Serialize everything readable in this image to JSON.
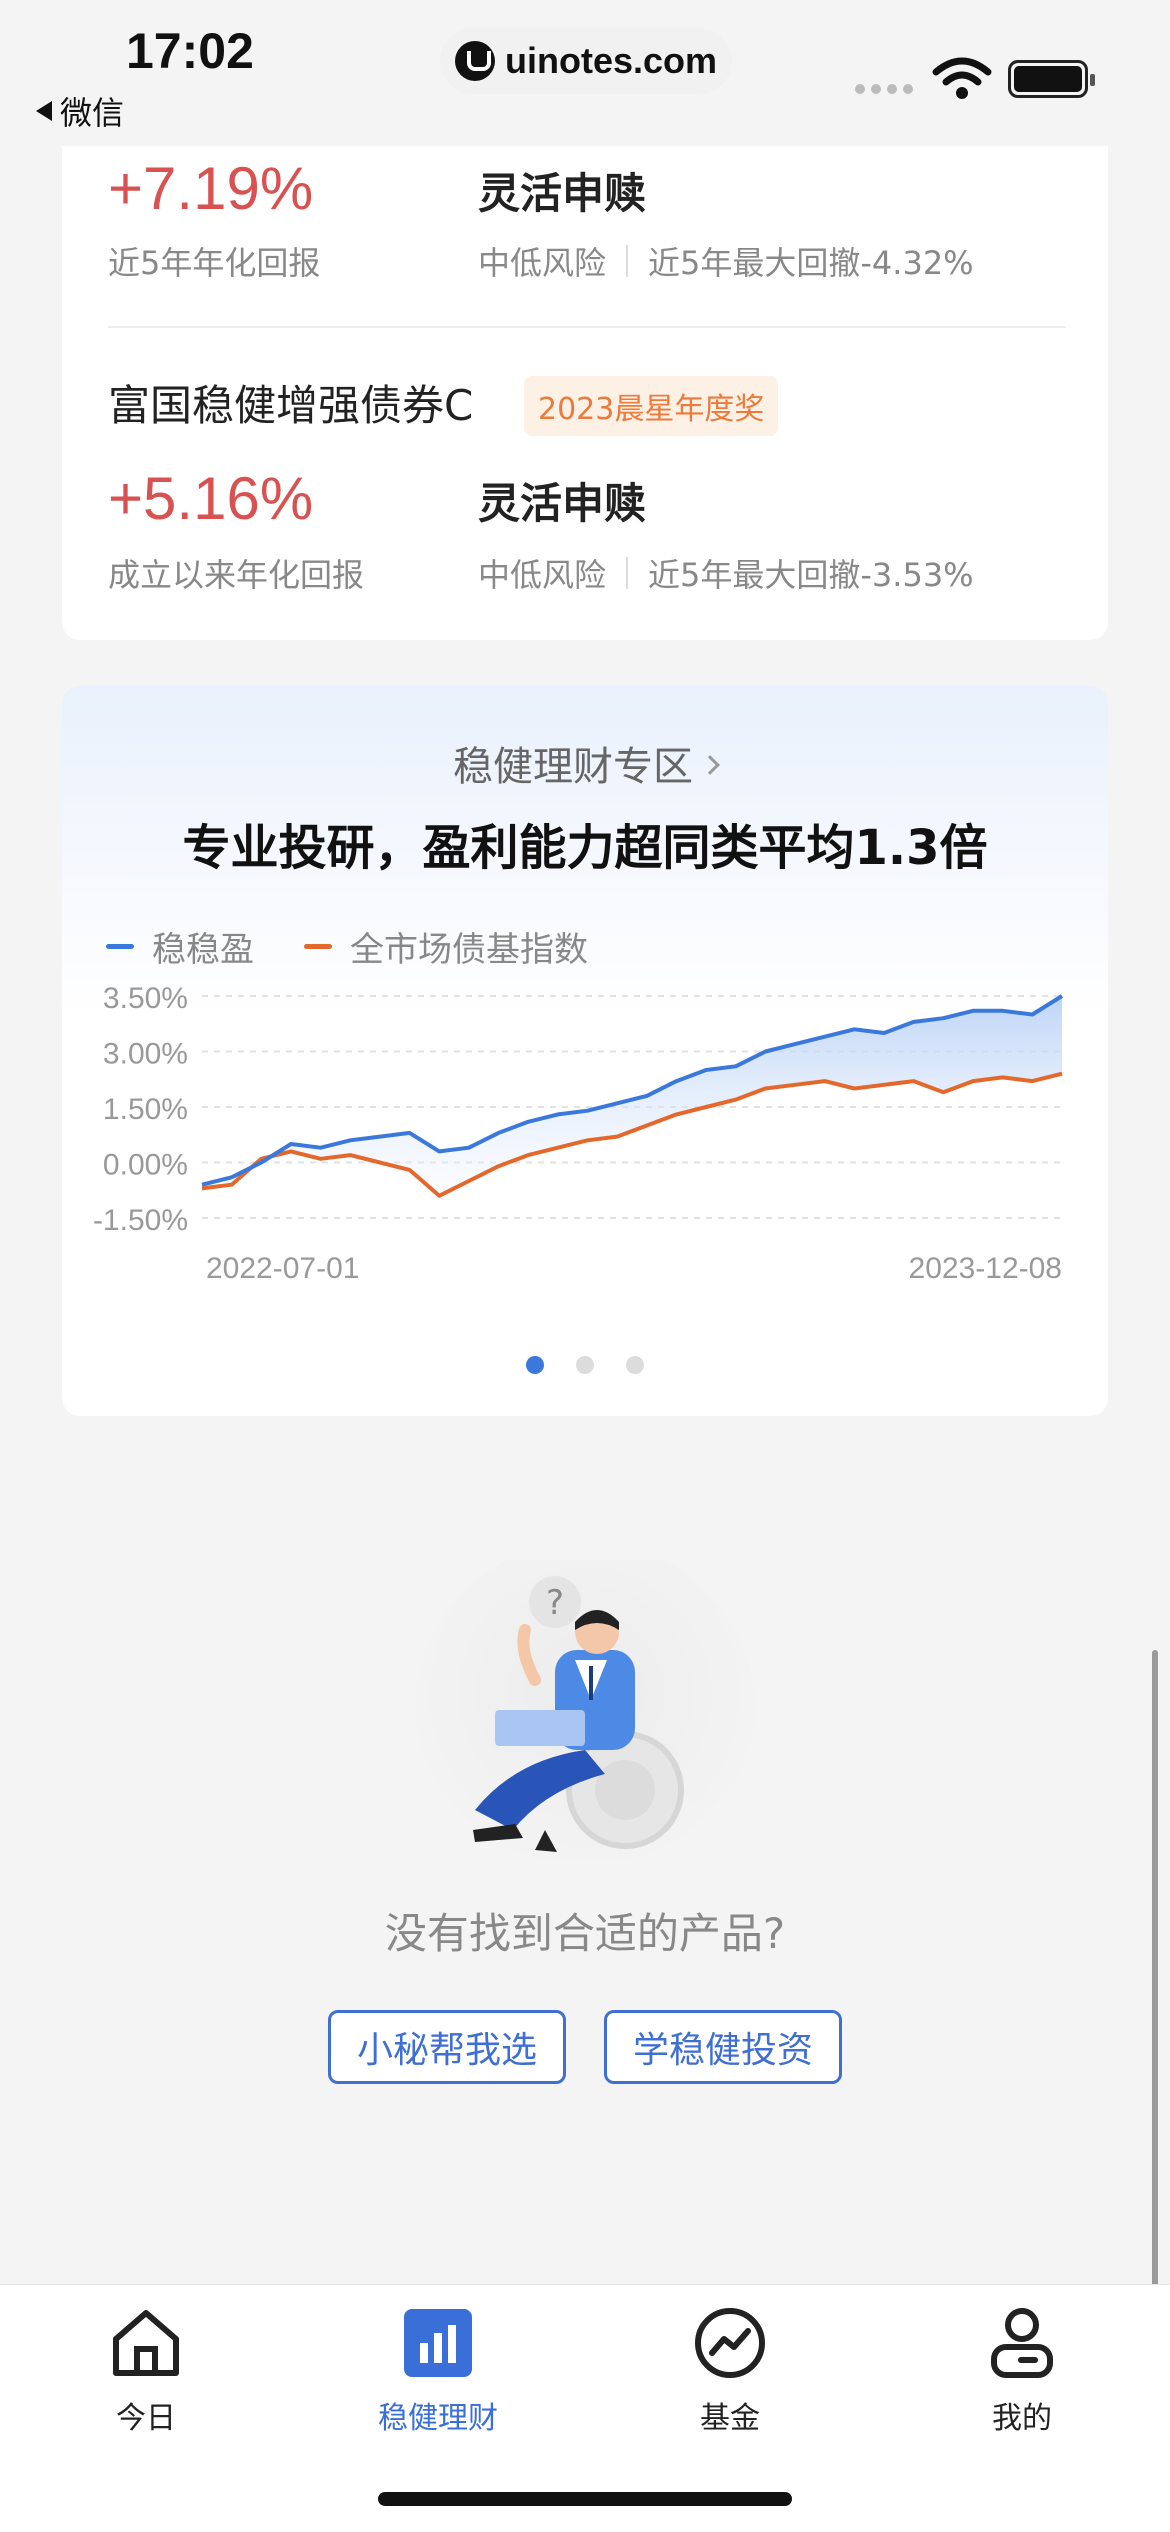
{
  "status_bar": {
    "time": "17:02",
    "back_app": "微信",
    "url": "uinotes.com"
  },
  "funds": [
    {
      "name": "",
      "award": "",
      "rate": "+7.19%",
      "rate_label": "近5年年化回报",
      "redeem": "灵活申赎",
      "risk": "中低风险",
      "drawdown": "近5年最大回撤-4.32%"
    },
    {
      "name": "富国稳健增强债券C",
      "award": "2023晨星年度奖",
      "rate": "+5.16%",
      "rate_label": "成立以来年化回报",
      "redeem": "灵活申赎",
      "risk": "中低风险",
      "drawdown": "近5年最大回撤-3.53%"
    }
  ],
  "zone": {
    "title": "稳健理财专区",
    "headline": "专业投研，盈利能力超同类平均1.3倍",
    "carousel_index": 0,
    "carousel_count": 3
  },
  "chart_data": {
    "type": "line",
    "x_start": "2022-07-01",
    "x_end": "2023-12-08",
    "y_ticks": [
      "3.50%",
      "3.00%",
      "1.50%",
      "0.00%",
      "-1.50%"
    ],
    "y_tick_values": [
      4.5,
      3.0,
      1.5,
      0.0,
      -1.5
    ],
    "ylim": [
      -1.5,
      4.5
    ],
    "grid": true,
    "legend_position": "top-left",
    "series": [
      {
        "name": "稳稳盈",
        "color": "#3b78dc",
        "values": [
          -0.6,
          -0.4,
          0.0,
          0.5,
          0.4,
          0.6,
          0.7,
          0.8,
          0.3,
          0.4,
          0.8,
          1.1,
          1.3,
          1.4,
          1.6,
          1.8,
          2.2,
          2.5,
          2.6,
          3.0,
          3.2,
          3.4,
          3.6,
          3.5,
          3.8,
          3.9,
          4.1,
          4.1,
          4.0,
          4.5
        ]
      },
      {
        "name": "全市场债基指数",
        "color": "#e4682c",
        "values": [
          -0.7,
          -0.6,
          0.1,
          0.3,
          0.1,
          0.2,
          0.0,
          -0.2,
          -0.9,
          -0.5,
          -0.1,
          0.2,
          0.4,
          0.6,
          0.7,
          1.0,
          1.3,
          1.5,
          1.7,
          2.0,
          2.1,
          2.2,
          2.0,
          2.1,
          2.2,
          1.9,
          2.2,
          2.3,
          2.2,
          2.4
        ]
      }
    ]
  },
  "empty_state": {
    "message": "没有找到合适的产品?",
    "button_left": "小秘帮我选",
    "button_right": "学稳健投资"
  },
  "tabbar": {
    "items": [
      {
        "label": "今日",
        "icon": "home-icon"
      },
      {
        "label": "稳健理财",
        "icon": "bar-chart-icon"
      },
      {
        "label": "基金",
        "icon": "trend-circle-icon"
      },
      {
        "label": "我的",
        "icon": "user-icon"
      }
    ],
    "active_index": 1,
    "active_color": "#3b6fd8"
  }
}
